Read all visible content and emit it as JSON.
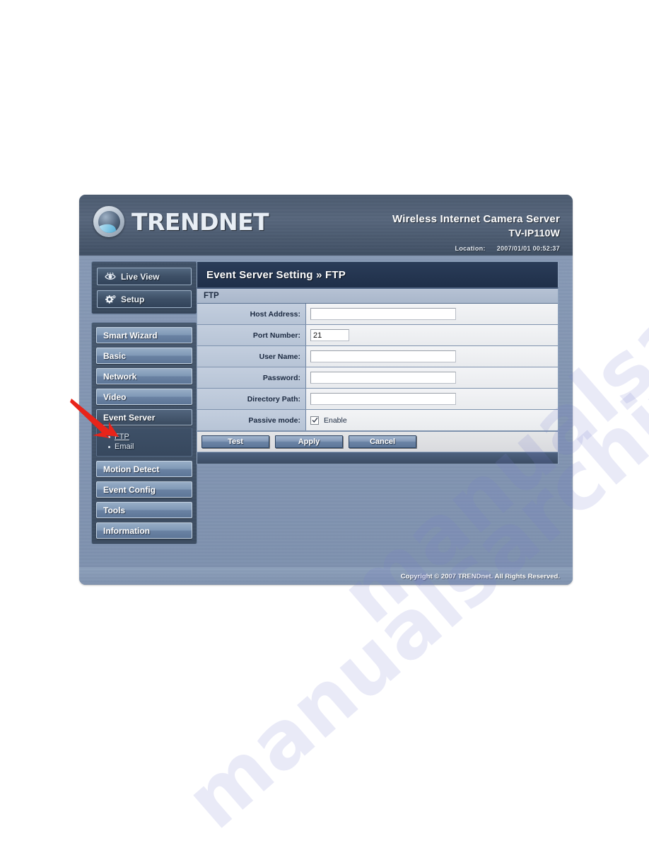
{
  "header": {
    "brand": "TRENDnet",
    "brand_display": "TRENDNET",
    "product_title": "Wireless Internet Camera Server",
    "model": "TV-IP110W",
    "location_label": "Location:",
    "location_value": "2007/01/01 00:52:37"
  },
  "sidebar": {
    "top_buttons": [
      {
        "label": "Live View",
        "icon": "eye-icon"
      },
      {
        "label": "Setup",
        "icon": "gear-icon"
      }
    ],
    "menu": [
      {
        "label": "Smart Wizard",
        "active": false
      },
      {
        "label": "Basic",
        "active": false
      },
      {
        "label": "Network",
        "active": false
      },
      {
        "label": "Video",
        "active": false
      },
      {
        "label": "Event Server",
        "active": true
      },
      {
        "label": "Motion Detect",
        "active": false
      },
      {
        "label": "Event Config",
        "active": false
      },
      {
        "label": "Tools",
        "active": false
      },
      {
        "label": "Information",
        "active": false
      }
    ],
    "submenu": [
      {
        "label": "FTP",
        "selected": true
      },
      {
        "label": "Email",
        "selected": false
      }
    ]
  },
  "panel": {
    "title": "Event Server Setting » FTP",
    "section": "FTP",
    "fields": [
      {
        "label": "Host Address:",
        "value": "",
        "type": "text",
        "size": "wide"
      },
      {
        "label": "Port Number:",
        "value": "21",
        "type": "text",
        "size": "narrow"
      },
      {
        "label": "User Name:",
        "value": "",
        "type": "text",
        "size": "wide"
      },
      {
        "label": "Password:",
        "value": "",
        "type": "password",
        "size": "wide"
      },
      {
        "label": "Directory Path:",
        "value": "",
        "type": "text",
        "size": "wide"
      },
      {
        "label": "Passive mode:",
        "value": "Enable",
        "type": "checkbox",
        "checked": true
      }
    ],
    "buttons": [
      {
        "label": "Test"
      },
      {
        "label": "Apply"
      },
      {
        "label": "Cancel"
      }
    ]
  },
  "footer": {
    "copyright": "Copyright © 2007 TRENDnet. All Rights Reserved."
  },
  "watermark": {
    "text": "manualsarchive.com"
  },
  "colors": {
    "frame_bg": "#7e95b5",
    "header_dark": "#4a5a70",
    "title_navy": "#24354f",
    "accent_button": "#8499b8",
    "annotation_red": "#e8241a"
  }
}
